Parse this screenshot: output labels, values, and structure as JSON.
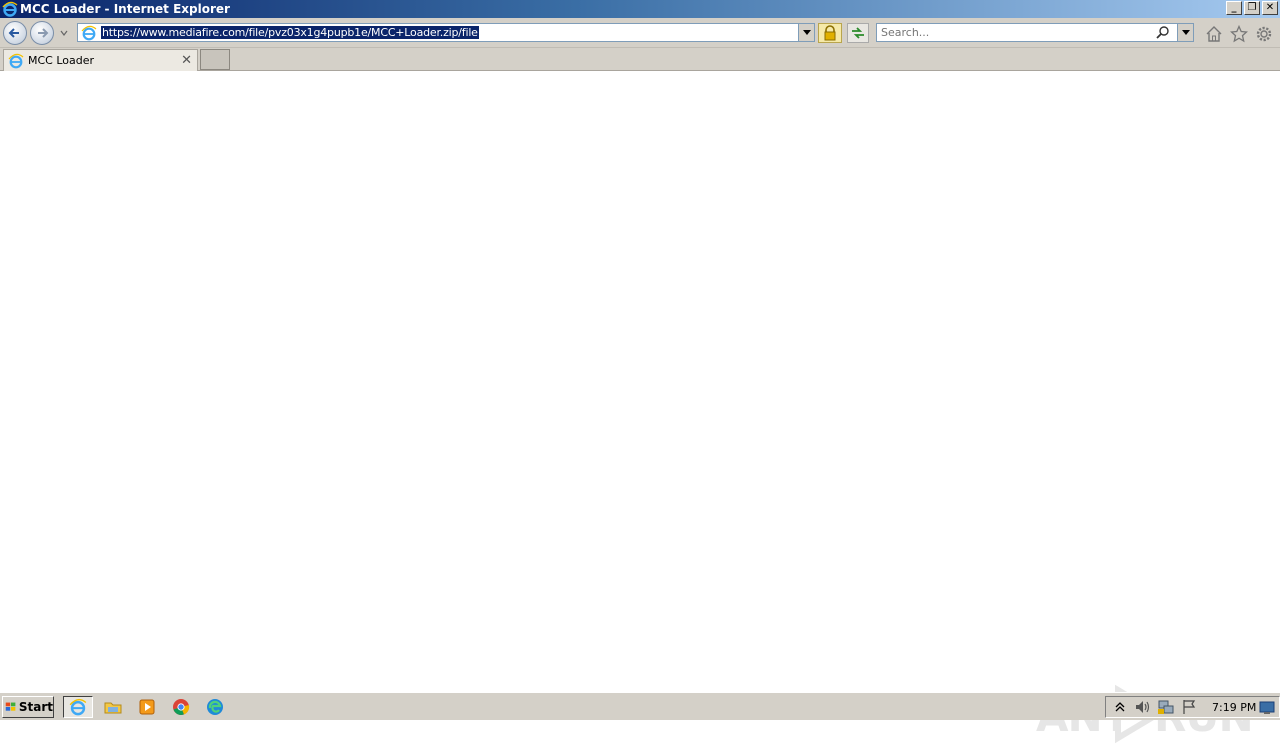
{
  "window": {
    "title": "MCC Loader - Internet Explorer",
    "controls": {
      "minimize": "_",
      "restore": "❐",
      "close": "✕"
    }
  },
  "navbar": {
    "address_url": "https://www.mediafire.com/file/pvz03x1g4pupb1e/MCC+Loader.zip/file",
    "search_placeholder": "Search..."
  },
  "tabs": [
    {
      "label": "MCC Loader",
      "close": "✕"
    }
  ],
  "watermark": {
    "text_left": "ANY",
    "text_right": "RUN"
  },
  "taskbar": {
    "start_label": "Start",
    "apps": [
      "internet-explorer-icon",
      "file-explorer-icon",
      "media-player-icon",
      "chrome-icon",
      "edge-icon"
    ],
    "tray_icons": [
      "show-hidden-icon",
      "volume-icon",
      "network-icon",
      "action-center-flag-icon"
    ],
    "clock": "7:19 PM"
  },
  "colors": {
    "titlebar_start": "#0a246a",
    "titlebar_end": "#a6caf0",
    "chrome": "#d4d0c8",
    "selection": "#0a246a"
  }
}
